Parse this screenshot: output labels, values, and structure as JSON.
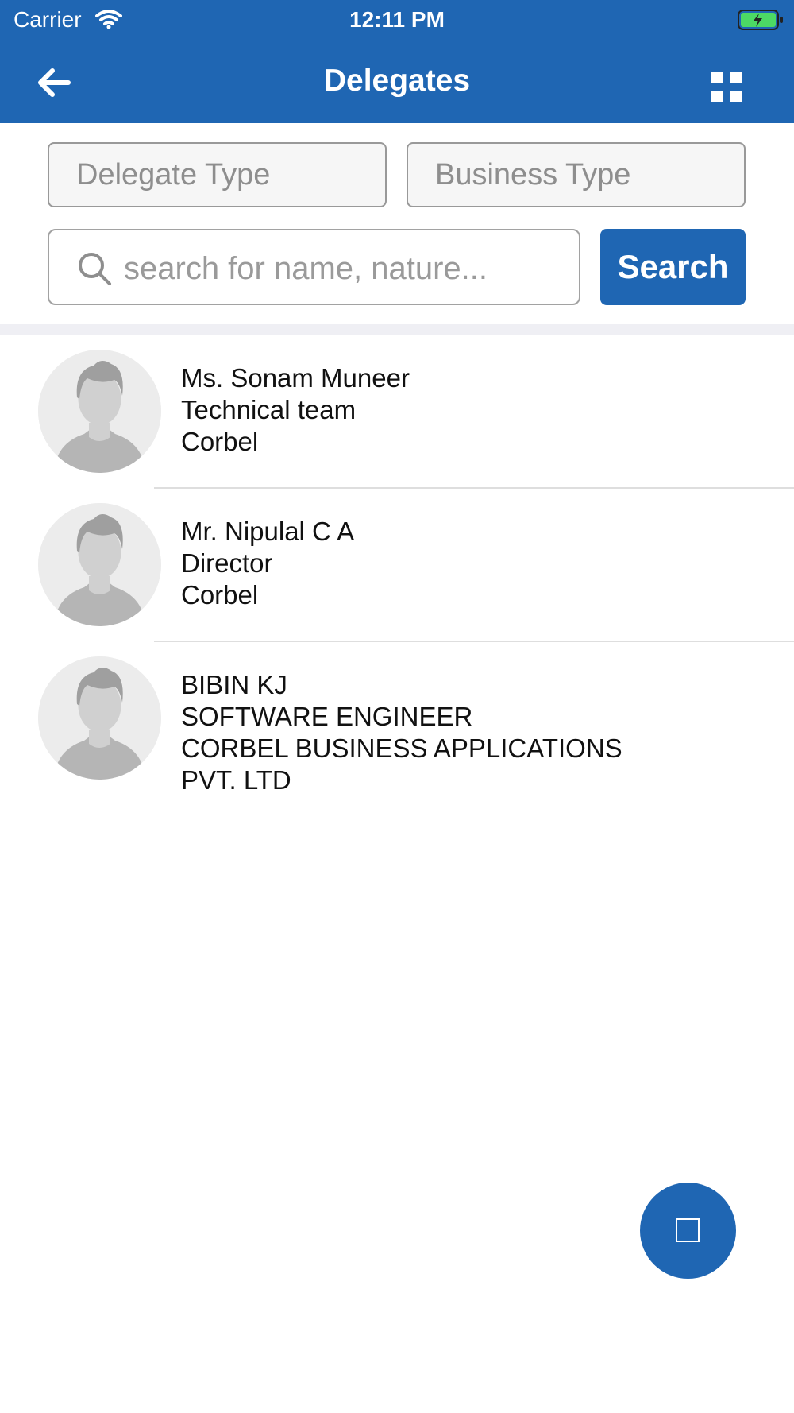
{
  "status_bar": {
    "carrier": "Carrier",
    "time": "12:11 PM"
  },
  "header": {
    "title": "Delegates",
    "back_icon": "arrow-left-icon",
    "menu_icon": "grid-icon"
  },
  "filters": {
    "delegate_type_placeholder": "Delegate Type",
    "business_type_placeholder": "Business Type"
  },
  "search": {
    "placeholder": "search for name, nature...",
    "value": "",
    "button_label": "Search"
  },
  "delegates": [
    {
      "name": "Ms. Sonam Muneer",
      "designation": "Technical team",
      "company": "Corbel"
    },
    {
      "name": "Mr. Nipulal C A",
      "designation": "Director",
      "company": "Corbel"
    },
    {
      "name": "BIBIN KJ",
      "designation": "SOFTWARE ENGINEER",
      "company": "CORBEL BUSINESS APPLICATIONS\nPVT. LTD"
    }
  ],
  "colors": {
    "primary": "#1f66b3",
    "divider": "#efeff4",
    "battery_fill": "#4cd964"
  }
}
